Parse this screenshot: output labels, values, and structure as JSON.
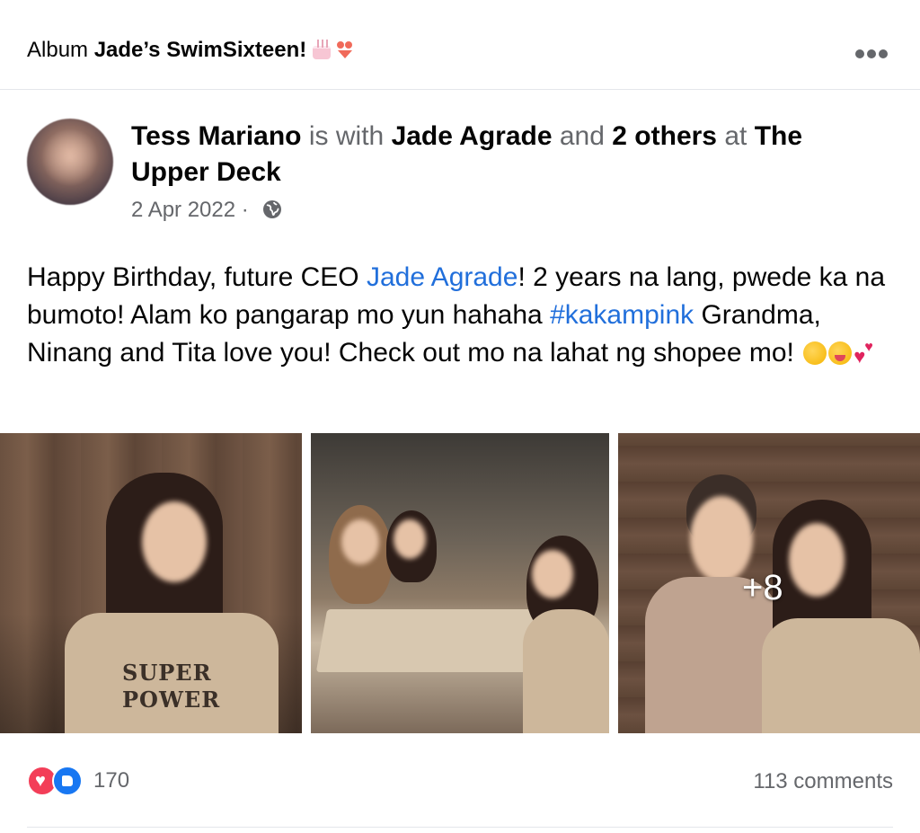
{
  "album": {
    "prefix": "Album",
    "name": "Jade’s SwimSixteen!",
    "emojis": [
      "birthday-cake",
      "bikini"
    ]
  },
  "post": {
    "author": "Tess Mariano",
    "with_text": "is with",
    "tagged": "Jade Agrade",
    "and_text": "and",
    "others": "2 others",
    "at_text": "at",
    "place": "The Upper Deck",
    "date": "2 Apr 2022",
    "separator": "·",
    "privacy_icon": "globe-icon",
    "text": {
      "part1": "Happy Birthday, future CEO ",
      "mention": "Jade Agrade",
      "part2": "! 2 years na lang, pwede ka na bumoto! Alam ko pangarap mo yun hahaha ",
      "hashtag": "#kakampink",
      "part3": " Grandma, Ninang and Tita love you! Check out mo na lahat ng shopee mo! ",
      "emojis": [
        "kissing-face",
        "zany-face",
        "two-hearts"
      ]
    }
  },
  "photos": {
    "shirt_text_1": "SUPER",
    "shirt_text_2": "POWER",
    "more_count": "+8"
  },
  "footer": {
    "reaction_count": "170",
    "comments": "113 comments"
  },
  "colors": {
    "link": "#216fdb",
    "secondary_text": "#65676b",
    "love": "#f33e58",
    "like": "#1877f2"
  }
}
